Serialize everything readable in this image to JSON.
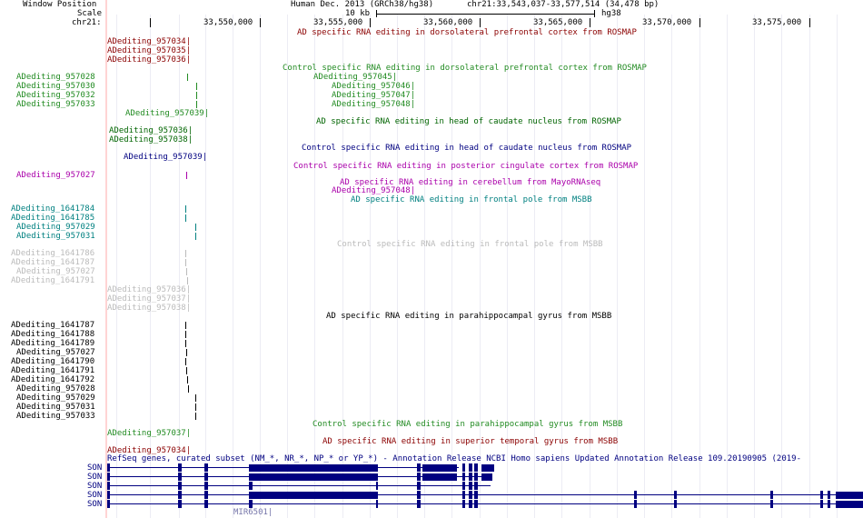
{
  "header": {
    "window_position_label": "Window Position",
    "scale_label": "Scale",
    "chrom_label": "chr21:",
    "assembly": "Human Dec. 2013 (GRCh38/hg38)",
    "position": "chr21:33,543,037-33,577,514 (34,478 bp)",
    "scale_value": "10 kb",
    "scale_assembly": "hg38",
    "ruler_ticks": [
      "33,550,000",
      "33,555,000",
      "33,560,000",
      "33,565,000",
      "33,570,000",
      "33,575,000"
    ]
  },
  "track_titles": {
    "ad_dlpfc": "AD specific RNA editing in dorsolateral prefrontal cortex from ROSMAP",
    "ctrl_dlpfc": "Control specific RNA editing in dorsolateral prefrontal cortex from ROSMAP",
    "ad_caudate": "AD specific RNA editing in head of caudate nucleus from ROSMAP",
    "ctrl_caudate": "Control specific RNA editing in head of caudate nucleus from ROSMAP",
    "ctrl_pcc": "Control specific RNA editing in posterior cingulate cortex from ROSMAP",
    "ad_cerebellum": "AD specific RNA editing in cerebellum from MayoRNAseq",
    "ad_frontal": "AD specific RNA editing in frontal pole from MSBB",
    "ctrl_frontal": "Control specific RNA editing in frontal pole from MSBB",
    "ad_parahip": "AD specific RNA editing in parahippocampal gyrus from MSBB",
    "ctrl_parahip": "Control specific RNA editing in parahippocampal gyrus from MSBB",
    "ad_stg": "AD specific RNA editing in superior temporal gyrus from MSBB",
    "refseq": "RefSeq genes, curated subset (NM_*, NR_*, NP_* or YP_*) - Annotation Release NCBI Homo sapiens Updated Annotation Release 109.20190905 (2019-"
  },
  "features": [
    {
      "label": "ADediting_957034|",
      "color": "#8b0000"
    },
    {
      "label": "ADediting_957035|",
      "color": "#8b0000"
    },
    {
      "label": "ADediting_957036|",
      "color": "#8b0000"
    },
    {
      "label": "ADediting_957045|",
      "color": "#228b22"
    },
    {
      "label": "ADediting_957028",
      "color": "#228b22"
    },
    {
      "label": "ADediting_957030",
      "color": "#228b22"
    },
    {
      "label": "ADediting_957046|",
      "color": "#228b22"
    },
    {
      "label": "ADediting_957032",
      "color": "#228b22"
    },
    {
      "label": "ADediting_957047|",
      "color": "#228b22"
    },
    {
      "label": "ADediting_957033",
      "color": "#228b22"
    },
    {
      "label": "ADediting_957048|",
      "color": "#228b22"
    },
    {
      "label": "ADediting_957039|",
      "color": "#228b22"
    },
    {
      "label": "ADediting_957036|",
      "color": "#006400"
    },
    {
      "label": "ADediting_957038|",
      "color": "#006400"
    },
    {
      "label": "ADediting_957039|",
      "color": "#000080"
    },
    {
      "label": "ADediting_957027",
      "color": "#aa00aa"
    },
    {
      "label": "ADediting_957048|",
      "color": "#aa00aa"
    },
    {
      "label": "ADediting_1641784",
      "color": "#008080"
    },
    {
      "label": "ADediting_1641785",
      "color": "#008080"
    },
    {
      "label": "ADediting_957029",
      "color": "#008080"
    },
    {
      "label": "ADediting_957031",
      "color": "#008080"
    },
    {
      "label": "ADediting_1641786",
      "color": "#bbbbbb"
    },
    {
      "label": "ADediting_1641787",
      "color": "#bbbbbb"
    },
    {
      "label": "ADediting_957027",
      "color": "#bbbbbb"
    },
    {
      "label": "ADediting_1641791",
      "color": "#bbbbbb"
    },
    {
      "label": "ADediting_957036|",
      "color": "#bbbbbb"
    },
    {
      "label": "ADediting_957037|",
      "color": "#bbbbbb"
    },
    {
      "label": "ADediting_957038|",
      "color": "#bbbbbb"
    },
    {
      "label": "ADediting_1641787",
      "color": "#000000"
    },
    {
      "label": "ADediting_1641788",
      "color": "#000000"
    },
    {
      "label": "ADediting_1641789",
      "color": "#000000"
    },
    {
      "label": "ADediting_957027",
      "color": "#000000"
    },
    {
      "label": "ADediting_1641790",
      "color": "#000000"
    },
    {
      "label": "ADediting_1641791",
      "color": "#000000"
    },
    {
      "label": "ADediting_1641792",
      "color": "#000000"
    },
    {
      "label": "ADediting_957028",
      "color": "#000000"
    },
    {
      "label": "ADediting_957029",
      "color": "#000000"
    },
    {
      "label": "ADediting_957031",
      "color": "#000000"
    },
    {
      "label": "ADediting_957033",
      "color": "#000000"
    },
    {
      "label": "ADediting_957037|",
      "color": "#228b22"
    },
    {
      "label": "ADediting_957034|",
      "color": "#8b0000"
    }
  ],
  "genes": {
    "names": [
      "SON",
      "SON",
      "SON",
      "SON",
      "SON"
    ],
    "mirna": "MIR6501|"
  },
  "colors": {
    "gene": "#000080",
    "grid": "#ececf4",
    "sidebar": "#ffd4d4"
  }
}
